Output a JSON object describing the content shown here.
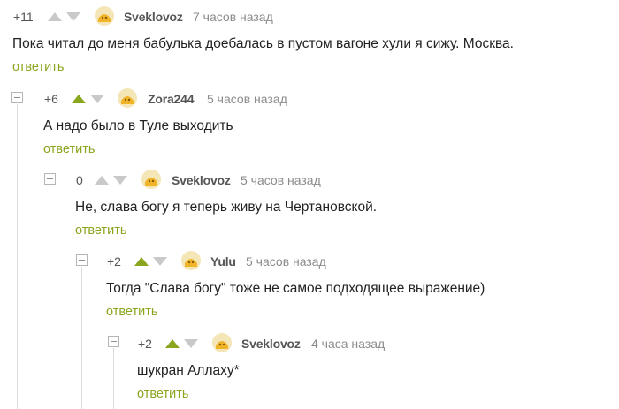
{
  "comments": [
    {
      "rating": "+11",
      "username": "Sveklovoz",
      "time": "7 часов назад",
      "text": "Пока читал до меня бабулька доебалась в пустом вагоне хули я сижу. Москва.",
      "reply": "ответить"
    },
    {
      "rating": "+6",
      "username": "Zora244",
      "time": "5 часов назад",
      "text": "А надо было в Туле выходить",
      "reply": "ответить"
    },
    {
      "rating": "0",
      "username": "Sveklovoz",
      "time": "5 часов назад",
      "text": "Не, слава богу я теперь живу на Чертановской.",
      "reply": "ответить"
    },
    {
      "rating": "+2",
      "username": "Yulu",
      "time": "5 часов назад",
      "text": "Тогда \"Слава богу\" тоже не самое подходящее выражение)",
      "reply": "ответить"
    },
    {
      "rating": "+2",
      "username": "Sveklovoz",
      "time": "4 часа назад",
      "text": "шукран Аллаху*",
      "reply": "ответить"
    }
  ],
  "icons": {
    "upvote": "arrow-up-icon",
    "downvote": "arrow-down-icon",
    "avatar": "default-avatar-icon",
    "collapse": "collapse-minus-icon"
  },
  "colors": {
    "upvote_positive": "#8aa51e",
    "upvote_neutral": "#c9c9c9",
    "downvote": "#c9c9c9",
    "reply_link": "#8aa51e",
    "meta_text": "#8b8b8b",
    "username": "#555555"
  }
}
